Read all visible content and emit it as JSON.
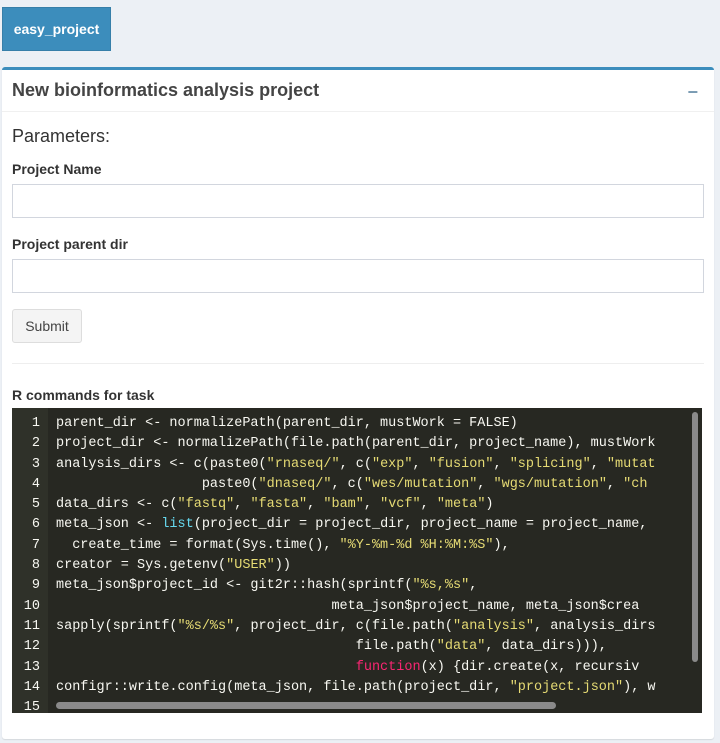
{
  "tab": {
    "label": "easy_project"
  },
  "box": {
    "title": "New bioinformatics analysis project",
    "collapse_icon": "minus-icon",
    "parameters_heading": "Parameters:",
    "fields": [
      {
        "label": "Project Name",
        "value": "",
        "placeholder": ""
      },
      {
        "label": "Project parent dir",
        "value": "",
        "placeholder": ""
      }
    ],
    "submit_label": "Submit",
    "commands_heading": "R commands for task"
  },
  "code_lines": [
    {
      "n": "1",
      "segs": [
        {
          "t": "parent_dir <- normalizePath(parent_dir, mustWork = FALSE)",
          "c": ""
        }
      ]
    },
    {
      "n": "2",
      "segs": [
        {
          "t": "project_dir <- normalizePath(file.path(parent_dir, project_name), mustWork",
          "c": ""
        }
      ]
    },
    {
      "n": "3",
      "segs": [
        {
          "t": "analysis_dirs <- c(paste0(",
          "c": ""
        },
        {
          "t": "\"rnaseq/\"",
          "c": "s"
        },
        {
          "t": ", c(",
          "c": ""
        },
        {
          "t": "\"exp\"",
          "c": "s"
        },
        {
          "t": ", ",
          "c": ""
        },
        {
          "t": "\"fusion\"",
          "c": "s"
        },
        {
          "t": ", ",
          "c": ""
        },
        {
          "t": "\"splicing\"",
          "c": "s"
        },
        {
          "t": ", ",
          "c": ""
        },
        {
          "t": "\"mutat",
          "c": "s"
        }
      ]
    },
    {
      "n": "4",
      "segs": [
        {
          "t": "                  paste0(",
          "c": ""
        },
        {
          "t": "\"dnaseq/\"",
          "c": "s"
        },
        {
          "t": ", c(",
          "c": ""
        },
        {
          "t": "\"wes/mutation\"",
          "c": "s"
        },
        {
          "t": ", ",
          "c": ""
        },
        {
          "t": "\"wgs/mutation\"",
          "c": "s"
        },
        {
          "t": ", ",
          "c": ""
        },
        {
          "t": "\"ch",
          "c": "s"
        }
      ]
    },
    {
      "n": "5",
      "segs": [
        {
          "t": "data_dirs <- c(",
          "c": ""
        },
        {
          "t": "\"fastq\"",
          "c": "s"
        },
        {
          "t": ", ",
          "c": ""
        },
        {
          "t": "\"fasta\"",
          "c": "s"
        },
        {
          "t": ", ",
          "c": ""
        },
        {
          "t": "\"bam\"",
          "c": "s"
        },
        {
          "t": ", ",
          "c": ""
        },
        {
          "t": "\"vcf\"",
          "c": "s"
        },
        {
          "t": ", ",
          "c": ""
        },
        {
          "t": "\"meta\"",
          "c": "s"
        },
        {
          "t": ")",
          "c": ""
        }
      ]
    },
    {
      "n": "6",
      "segs": [
        {
          "t": "meta_json <- ",
          "c": ""
        },
        {
          "t": "list",
          "c": "f"
        },
        {
          "t": "(project_dir = project_dir, project_name = project_name,",
          "c": ""
        }
      ]
    },
    {
      "n": "7",
      "segs": [
        {
          "t": "  create_time = format(Sys.time(), ",
          "c": ""
        },
        {
          "t": "\"%Y-%m-%d %H:%M:%S\"",
          "c": "s"
        },
        {
          "t": "),",
          "c": ""
        }
      ]
    },
    {
      "n": "8",
      "segs": [
        {
          "t": "creator = Sys.getenv(",
          "c": ""
        },
        {
          "t": "\"USER\"",
          "c": "s"
        },
        {
          "t": "))",
          "c": ""
        }
      ]
    },
    {
      "n": "9",
      "segs": [
        {
          "t": "meta_json$project_id <- git2r::hash(sprintf(",
          "c": ""
        },
        {
          "t": "\"%s,%s\"",
          "c": "s"
        },
        {
          "t": ",",
          "c": ""
        }
      ]
    },
    {
      "n": "10",
      "segs": [
        {
          "t": "                                  meta_json$project_name, meta_json$crea",
          "c": ""
        }
      ]
    },
    {
      "n": "11",
      "segs": [
        {
          "t": "sapply(sprintf(",
          "c": ""
        },
        {
          "t": "\"%s/%s\"",
          "c": "s"
        },
        {
          "t": ", project_dir, c(file.path(",
          "c": ""
        },
        {
          "t": "\"analysis\"",
          "c": "s"
        },
        {
          "t": ", analysis_dirs",
          "c": ""
        }
      ]
    },
    {
      "n": "12",
      "segs": [
        {
          "t": "                                     file.path(",
          "c": ""
        },
        {
          "t": "\"data\"",
          "c": "s"
        },
        {
          "t": ", data_dirs))),",
          "c": ""
        }
      ]
    },
    {
      "n": "13",
      "segs": [
        {
          "t": "                                     ",
          "c": ""
        },
        {
          "t": "function",
          "c": "k"
        },
        {
          "t": "(x) {dir.create(x, recursiv",
          "c": ""
        }
      ]
    },
    {
      "n": "14",
      "segs": [
        {
          "t": "configr::write.config(meta_json, file.path(project_dir, ",
          "c": ""
        },
        {
          "t": "\"project.json\"",
          "c": "s"
        },
        {
          "t": "), w",
          "c": ""
        }
      ]
    },
    {
      "n": "15",
      "segs": [
        {
          "t": "",
          "c": ""
        }
      ]
    }
  ]
}
